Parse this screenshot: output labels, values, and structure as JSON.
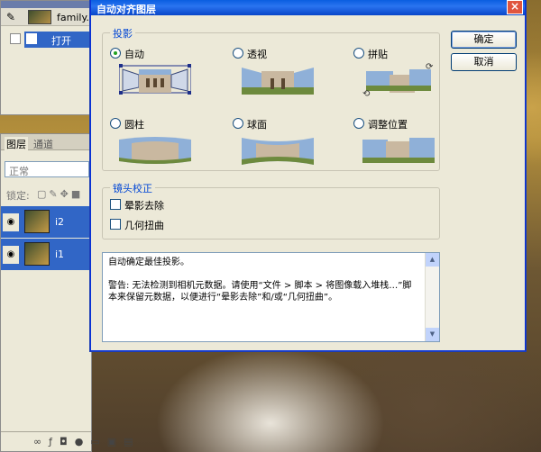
{
  "history_panel": {
    "snapshot_name": "family.tif",
    "action_label": "打开"
  },
  "layers_panel": {
    "tab_layers": "图层",
    "tab_channels": "通道",
    "blend_mode": "正常",
    "lock_label": "锁定:",
    "layers": [
      {
        "name": "i2"
      },
      {
        "name": "i1"
      }
    ]
  },
  "dialog": {
    "title": "自动对齐图层",
    "close_glyph": "×",
    "projection": {
      "legend": "投影",
      "options": [
        {
          "label": "自动",
          "selected": true
        },
        {
          "label": "透视",
          "selected": false
        },
        {
          "label": "拼贴",
          "selected": false
        },
        {
          "label": "圆柱",
          "selected": false
        },
        {
          "label": "球面",
          "selected": false
        },
        {
          "label": "调整位置",
          "selected": false
        }
      ]
    },
    "lens": {
      "legend": "镜头校正",
      "vignette_label": "晕影去除",
      "distortion_label": "几何扭曲"
    },
    "buttons": {
      "ok": "确定",
      "cancel": "取消"
    },
    "description": {
      "line1": "自动确定最佳投影。",
      "line2": "警告: 无法检测到相机元数据。请使用“文件 > 脚本 > 将图像载入堆栈…”脚本来保留元数据，以便进行“晕影去除”和/或“几何扭曲”。"
    }
  }
}
